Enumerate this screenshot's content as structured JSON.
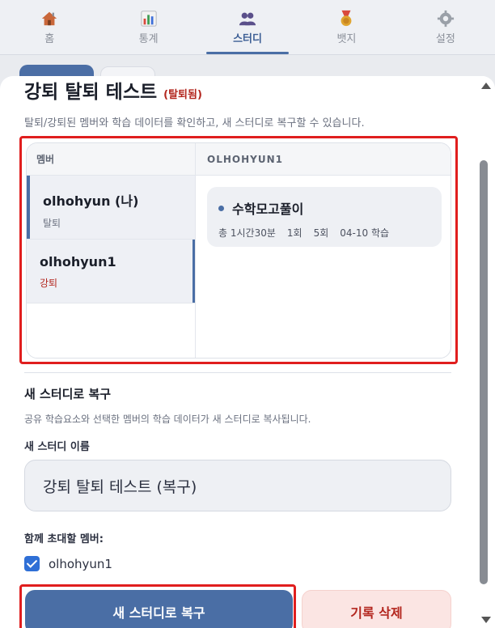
{
  "nav": {
    "tabs": [
      {
        "label": "홈",
        "icon": "home-icon"
      },
      {
        "label": "통계",
        "icon": "bar-chart-icon"
      },
      {
        "label": "스터디",
        "icon": "people-icon"
      },
      {
        "label": "뱃지",
        "icon": "medal-icon"
      },
      {
        "label": "설정",
        "icon": "gear-icon"
      }
    ],
    "active": "스터디"
  },
  "modal": {
    "title": "강퇴 탈퇴 테스트",
    "title_badge": "(탈퇴됨)",
    "description": "탈퇴/강퇴된 멤버와 학습 데이터를 확인하고, 새 스터디로 복구할 수 있습니다.",
    "members_header": "멤버",
    "members": [
      {
        "name": "olhohyun (나)",
        "status": "탈퇴"
      },
      {
        "name": "olhohyun1",
        "status": "강퇴"
      }
    ],
    "selected_member_header": "OLHOHYUN1",
    "record": {
      "title": "수학모고풀이",
      "total": "총 1시간30분",
      "count1": "1회",
      "count2": "5회",
      "date": "04-10 학습"
    },
    "restore_title": "새 스터디로 복구",
    "restore_description": "공유 학습요소와 선택한 멤버의 학습 데이터가 새 스터디로 복사됩니다.",
    "new_name_label": "새 스터디 이름",
    "new_name_value": "강퇴 탈퇴 테스트 (복구)",
    "invite_label": "함께 초대할 멤버:",
    "invite_member": "olhohyun1",
    "restore_button": "새 스터디로 복구",
    "delete_button": "기록 삭제"
  },
  "colors": {
    "accent": "#4a6ea5",
    "danger": "#b3261e",
    "highlight": "#e01e1e"
  }
}
